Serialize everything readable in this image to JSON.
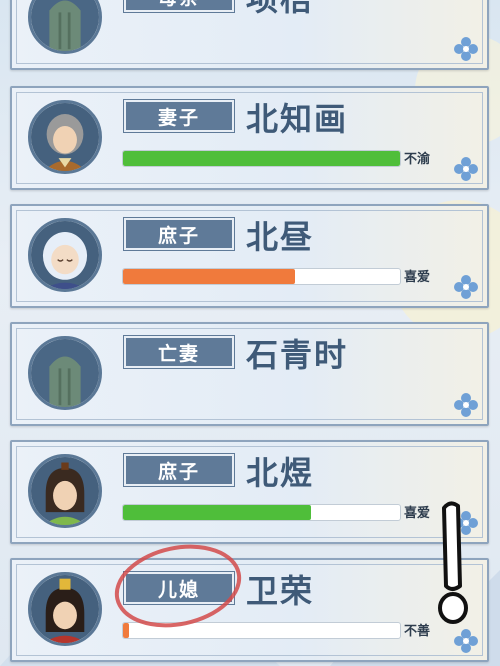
{
  "cards": [
    {
      "role": "母亲",
      "name": "项梧",
      "avatar": "ghost-tomb-avatar"
    },
    {
      "role": "妻子",
      "name": "北知画",
      "mood": "不渝",
      "affection": 1.0,
      "bar_color": "#4fbe3a",
      "avatar": "grey-hair-woman-avatar"
    },
    {
      "role": "庶子",
      "name": "北昼",
      "mood": "喜爱",
      "affection": 0.62,
      "bar_color": "#f07a3c",
      "avatar": "sleeping-baby-avatar"
    },
    {
      "role": "亡妻",
      "name": "石青时",
      "avatar": "ghost-tomb-avatar"
    },
    {
      "role": "庶子",
      "name": "北煜",
      "mood": "喜爱",
      "affection": 0.68,
      "bar_color": "#4fbe3a",
      "avatar": "young-man-avatar"
    },
    {
      "role": "儿媳",
      "name": "卫荣",
      "mood": "不善",
      "affection": 0.02,
      "bar_color": "#f07a3c",
      "avatar": "young-woman-avatar"
    }
  ],
  "colors": {
    "border": "#5b7896",
    "tag": "#5f7a98",
    "name": "#3f5a78",
    "annotation": "#d24a4a"
  },
  "icons": {
    "card_corner": "snowflake-flower-icon"
  }
}
